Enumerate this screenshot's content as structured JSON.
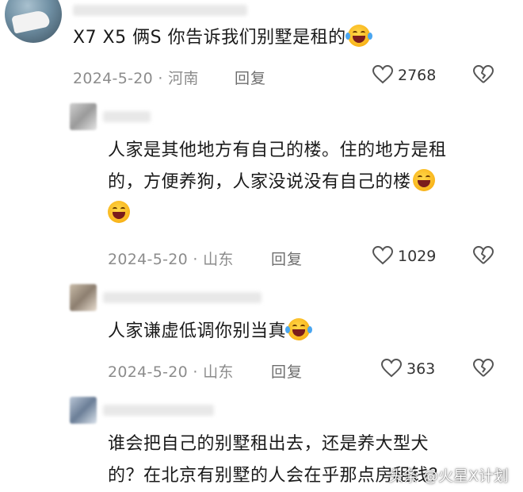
{
  "comments": [
    {
      "text": "X7 X5 俩S 你告诉我们别墅是租的",
      "emoji": "laugh-cry",
      "date": "2024-5-20",
      "location": "河南",
      "reply_label": "回复",
      "likes": "2768"
    },
    {
      "text_line1": "人家是其他地方有自己的楼。住的地方是租",
      "text_line2": "的，方便养狗，人家没说没有自己的楼",
      "emoji": "grin-laugh",
      "date": "2024-5-20",
      "location": "山东",
      "reply_label": "回复",
      "likes": "1029"
    },
    {
      "text": "人家谦虚低调你别当真",
      "emoji": "laugh-cry",
      "date": "2024-5-20",
      "location": "山东",
      "reply_label": "回复",
      "likes": "363"
    },
    {
      "text_line1": "谁会把自己的别墅租出去，还是养大型犬",
      "text_line2": "的？在北京有别墅的人会在乎那点房租钱？"
    }
  ],
  "watermark": "头条 @火星X计划",
  "colors": {
    "like_icon": "#555555",
    "meta_text": "#8c8c8c"
  }
}
